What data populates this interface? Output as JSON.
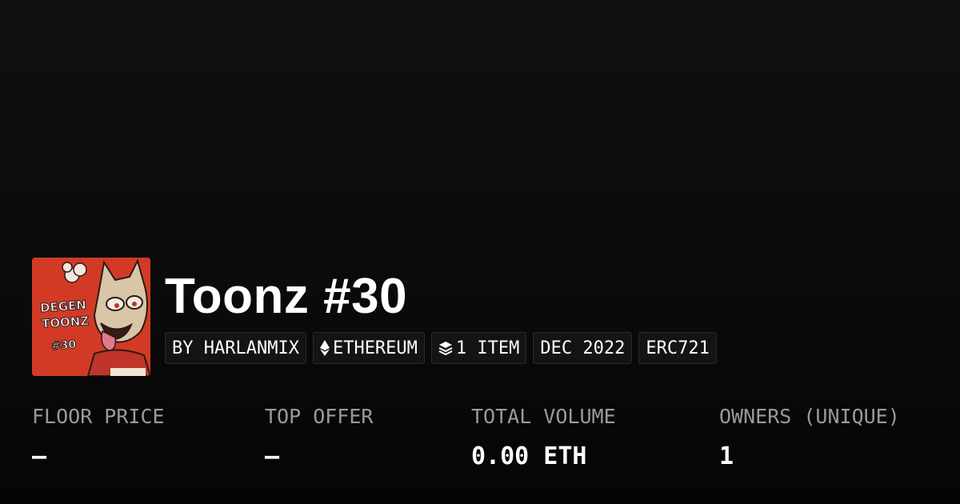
{
  "item": {
    "title": "Toonz #30",
    "avatar_icon": "degen-toonz-artwork",
    "avatar_text": [
      "DEGEN",
      "TOONZ",
      "#30"
    ]
  },
  "tags": [
    {
      "label": "BY HARLANMIX"
    },
    {
      "label": "ETHEREUM",
      "icon": "ethereum-icon"
    },
    {
      "label": "1 ITEM",
      "icon": "layers-icon"
    },
    {
      "label": "DEC 2022"
    },
    {
      "label": "ERC721"
    }
  ],
  "stats": [
    {
      "label": "FLOOR PRICE",
      "value": "—"
    },
    {
      "label": "TOP OFFER",
      "value": "—"
    },
    {
      "label": "TOTAL VOLUME",
      "value": "0.00 ETH"
    },
    {
      "label": "OWNERS (UNIQUE)",
      "value": "1"
    }
  ],
  "colors": {
    "background": "#0b0b0b",
    "avatar_bg": "#d23a26",
    "label": "#9a9a9a",
    "tag_bg": "#141414"
  }
}
